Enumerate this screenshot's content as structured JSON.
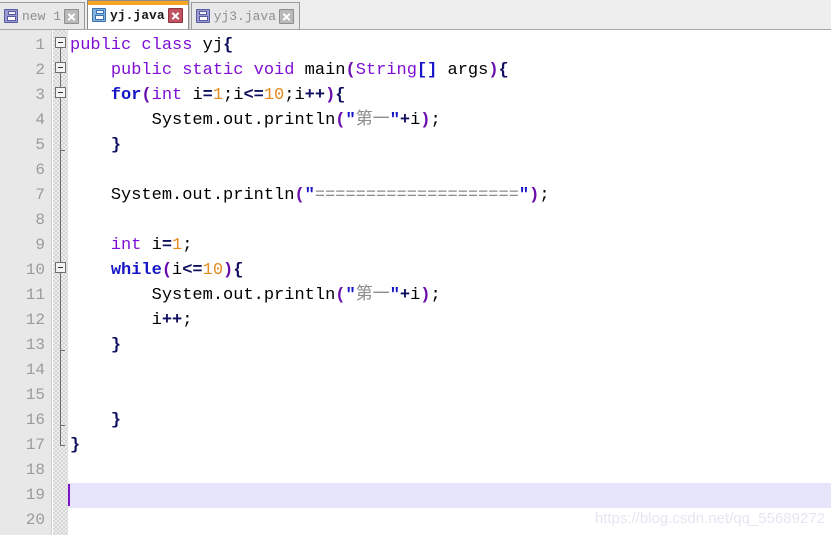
{
  "window": {
    "kind": "java-source-editor"
  },
  "tabs": [
    {
      "label": "new 1",
      "icon": "floppy-disk-icon",
      "close_icon": "close-icon",
      "active": false,
      "modified": true
    },
    {
      "label": "yj.java",
      "icon": "floppy-disk-icon",
      "close_icon": "close-icon",
      "active": true,
      "modified": false
    },
    {
      "label": "yj3.java",
      "icon": "floppy-disk-icon",
      "close_icon": "close-icon",
      "active": false,
      "modified": true
    }
  ],
  "editor": {
    "line_numbers": [
      "1",
      "2",
      "3",
      "4",
      "5",
      "6",
      "7",
      "8",
      "9",
      "10",
      "11",
      "12",
      "13",
      "14",
      "15",
      "16",
      "17",
      "18",
      "19",
      "20"
    ],
    "current_line": 19,
    "caret_column": 1,
    "total_lines": 20,
    "language": "Java",
    "lines": [
      {
        "n": 1,
        "text": "public class yj{"
      },
      {
        "n": 2,
        "text": "    public static void main(String[] args){"
      },
      {
        "n": 3,
        "text": "    for(int i=1;i<=10;i++){"
      },
      {
        "n": 4,
        "text": "        System.out.println(\"第一\"+i);"
      },
      {
        "n": 5,
        "text": "    }"
      },
      {
        "n": 6,
        "text": ""
      },
      {
        "n": 7,
        "text": "    System.out.println(\"====================\");"
      },
      {
        "n": 8,
        "text": ""
      },
      {
        "n": 9,
        "text": "    int i=1;"
      },
      {
        "n": 10,
        "text": "    while(i<=10){"
      },
      {
        "n": 11,
        "text": "        System.out.println(\"第一\"+i);"
      },
      {
        "n": 12,
        "text": "        i++;"
      },
      {
        "n": 13,
        "text": "    }"
      },
      {
        "n": 14,
        "text": ""
      },
      {
        "n": 15,
        "text": ""
      },
      {
        "n": 16,
        "text": "    }"
      },
      {
        "n": 17,
        "text": "}"
      },
      {
        "n": 18,
        "text": ""
      },
      {
        "n": 19,
        "text": ""
      },
      {
        "n": 20,
        "text": ""
      }
    ],
    "fold_markers": [
      1,
      2,
      3,
      10
    ]
  },
  "watermark": {
    "text": "https://blog.csdn.net/qq_55689272"
  },
  "colors": {
    "keyword_purple": "#7f0fd4",
    "keyword_blue": "#1616c8",
    "number_orange": "#e28b1e",
    "string_gray": "#8c8c8c",
    "active_tab_accent": "#f5a623",
    "current_line_highlight": "#e6e4fa",
    "caret": "#7b12c8",
    "gutter_bg": "#e8e8e8",
    "line_number_text": "#9b9b9b"
  }
}
